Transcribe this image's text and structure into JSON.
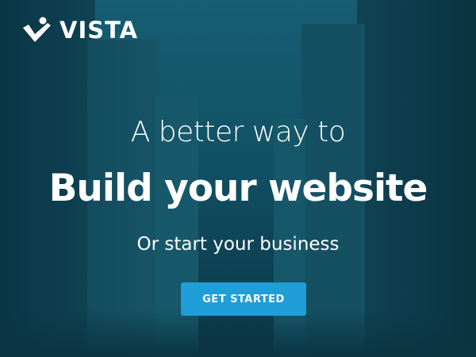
{
  "brand": {
    "name": "VISTA",
    "logo_icon": "checkmark-star-icon"
  },
  "hero": {
    "headline_line1": "A better way to",
    "headline_line2": "Build your website",
    "subheadline": "Or start your business",
    "cta_label": "GET STARTED"
  },
  "colors": {
    "cta_background": "#1f9ed8",
    "text": "#ffffff",
    "overlay": "#145467"
  }
}
